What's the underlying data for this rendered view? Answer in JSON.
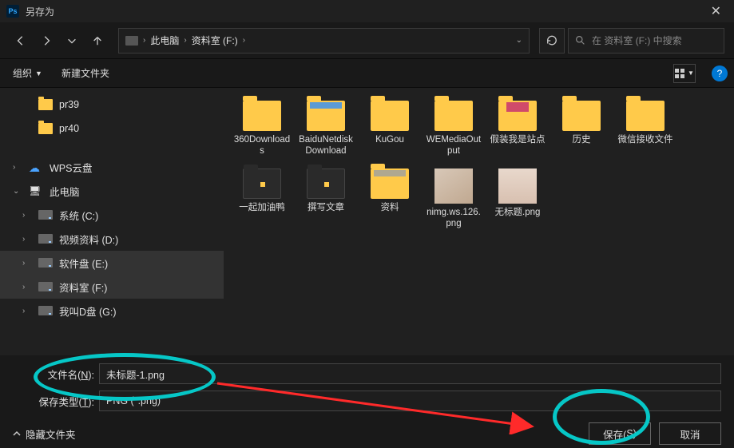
{
  "titlebar": {
    "title": "另存为"
  },
  "nav": {
    "breadcrumb": [
      "此电脑",
      "资料室 (F:)"
    ],
    "search_placeholder": "在 资料室 (F:) 中搜索"
  },
  "toolbar": {
    "organize": "组织",
    "newfolder": "新建文件夹"
  },
  "tree": {
    "pr39": "pr39",
    "pr40": "pr40",
    "wps": "WPS云盘",
    "thispc": "此电脑",
    "drives": [
      "系统 (C:)",
      "视频资料 (D:)",
      "软件盘 (E:)",
      "资料室 (F:)",
      "我叫D盘 (G:)"
    ]
  },
  "files": {
    "row1": [
      "360Downloads",
      "BaiduNetdiskDownload",
      "KuGou",
      "WEMediaOutput",
      "假装我是站点",
      "历史",
      "微信接收文件",
      "一起加油鸭"
    ],
    "row2": [
      "撰写文章",
      "资料",
      "nimg.ws.126.png",
      "无标题.png"
    ]
  },
  "form": {
    "filename_label": "文件名(N):",
    "filename_value": "未标题-1.png",
    "type_label": "保存类型(T):",
    "type_value": "PNG (*.png)"
  },
  "bottom": {
    "hide": "隐藏文件夹",
    "save": "保存(S)",
    "cancel": "取消"
  }
}
